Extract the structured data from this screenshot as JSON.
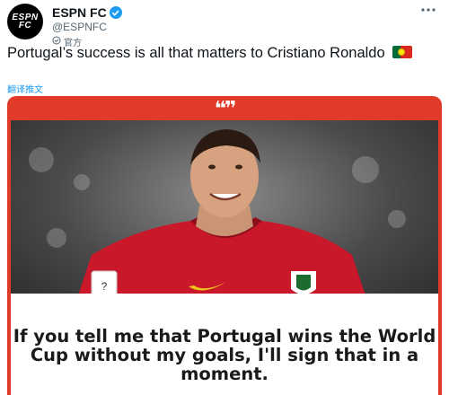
{
  "account": {
    "avatar_text": "ESPN FC",
    "display_name": "ESPN FC",
    "handle": "@ESPNFC",
    "official_label": "官方",
    "more_icon": "ellipsis-icon",
    "verified_icon": "verified-badge-icon"
  },
  "tweet": {
    "text": "Portugal’s success is all that matters to Cristiano Ronaldo",
    "flag_emoji": "portugal-flag-icon",
    "translate_label": "翻译推文"
  },
  "card": {
    "quote_mark": "❛❛❜❜",
    "quote_text": "If you tell me that Portugal wins the World Cup without my goals, I'll sign that in a moment.",
    "accent_color": "#e03a29",
    "jersey_color": "#c8182a"
  },
  "colors": {
    "link": "#1d9bf0",
    "secondary_text": "#536471",
    "text": "#0f1419"
  }
}
